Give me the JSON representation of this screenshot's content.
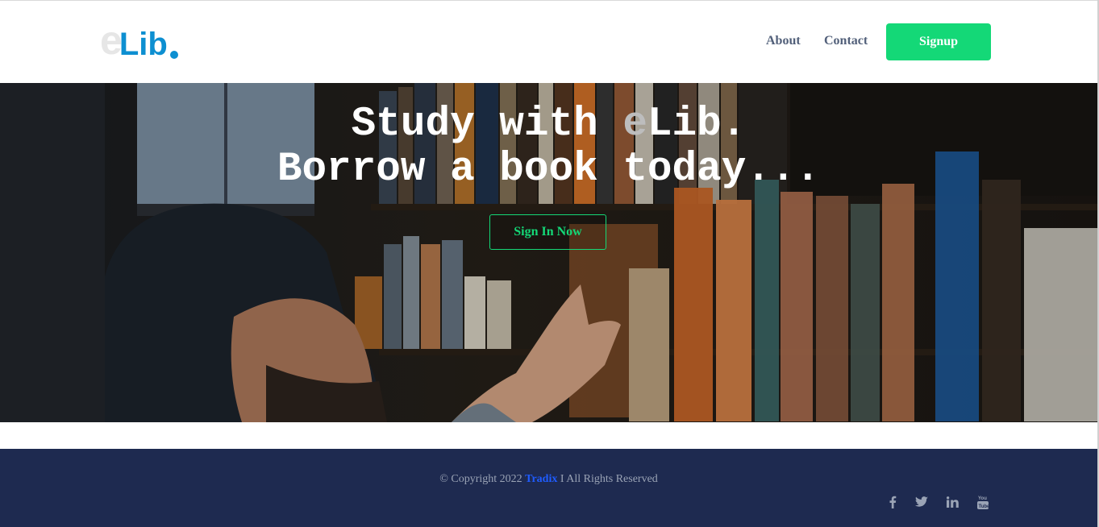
{
  "header": {
    "logo_e": "e",
    "logo_lib": "Lib",
    "nav": {
      "about": "About",
      "contact": "Contact"
    },
    "signup_label": "Signup"
  },
  "hero": {
    "line1_prefix": "Study with ",
    "line1_accent": "e",
    "line1_suffix": "Lib.",
    "line2": "Borrow a book today...",
    "signin_label": "Sign In Now"
  },
  "footer": {
    "copyright_prefix": "© Copyright 2022 ",
    "brand": "Tradix",
    "copyright_suffix": " I All Rights Reserved",
    "social_icons": [
      "facebook-icon",
      "twitter-icon",
      "linkedin-icon",
      "youtube-icon"
    ]
  },
  "colors": {
    "accent_green": "#14d877",
    "logo_blue": "#0d8fd1",
    "footer_bg": "#1e2a50",
    "nav_text": "#52607a",
    "brand_link": "#1f5cff"
  }
}
